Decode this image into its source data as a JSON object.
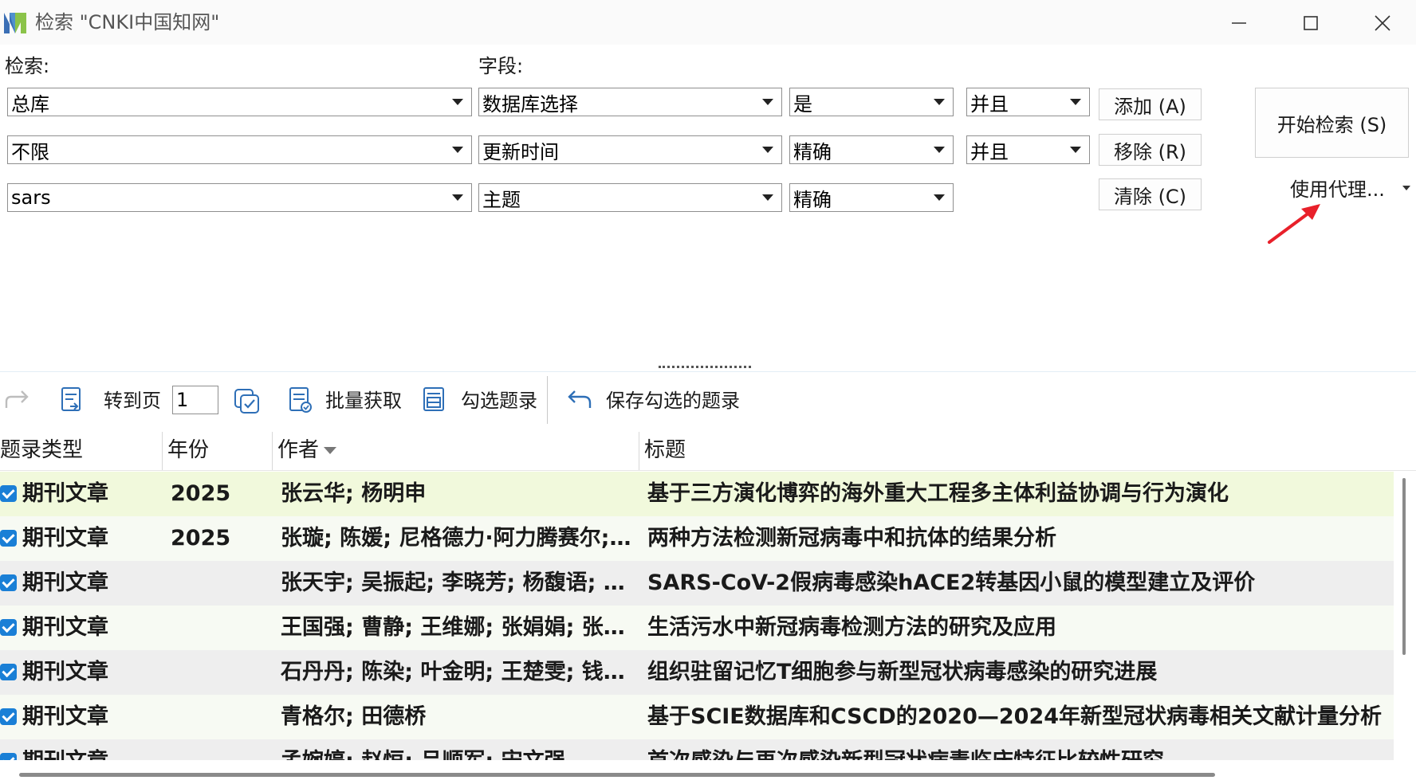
{
  "window": {
    "title": "检索 \"CNKI中国知网\"",
    "icons": {
      "minimize": "minimize-icon",
      "maximize": "maximize-icon",
      "close": "close-icon"
    }
  },
  "form": {
    "search_label": "检索:",
    "field_label": "字段:",
    "rows": [
      {
        "scope": "总库",
        "field": "数据库选择",
        "match": "是",
        "logic": "并且"
      },
      {
        "scope": "不限",
        "field": "更新时间",
        "match": "精确",
        "logic": "并且"
      },
      {
        "scope": "sars",
        "field": "主题",
        "match": "精确"
      }
    ],
    "add_label": "添加 (A)",
    "remove_label": "移除 (R)",
    "clear_label": "清除 (C)",
    "start_label": "开始检索 (S)",
    "proxy_label": "使用代理..."
  },
  "toolbar": {
    "goto_label": "转到页",
    "page_value": "1",
    "batch_label": "批量获取",
    "select_label": "勾选题录",
    "save_label": "保存勾选的题录"
  },
  "table": {
    "columns": [
      "题录类型",
      "年份",
      "作者",
      "标题"
    ],
    "rows": [
      {
        "checked": true,
        "type": "期刊文章",
        "year": "2025",
        "authors": "张云华; 杨明申",
        "title": "基于三方演化博弈的海外重大工程多主体利益协调与行为演化"
      },
      {
        "checked": true,
        "type": "期刊文章",
        "year": "2025",
        "authors": "张璇; 陈媛; 尼格德力·阿力腾赛尔; ...",
        "title": "两种方法检测新冠病毒中和抗体的结果分析"
      },
      {
        "checked": true,
        "type": "期刊文章",
        "year": "",
        "authors": "张天宇; 吴振起; 李晓芳; 杨馥语; 王...",
        "title": "SARS-CoV-2假病毒感染hACE2转基因小鼠的模型建立及评价"
      },
      {
        "checked": true,
        "type": "期刊文章",
        "year": "",
        "authors": "王国强; 曹静; 王维娜; 张娟娟; 张媛...",
        "title": "生活污水中新冠病毒检测方法的研究及应用"
      },
      {
        "checked": true,
        "type": "期刊文章",
        "year": "",
        "authors": "石丹丹; 陈染; 叶金明; 王楚雯; 钱国清",
        "title": "组织驻留记忆T细胞参与新型冠状病毒感染的研究进展"
      },
      {
        "checked": true,
        "type": "期刊文章",
        "year": "",
        "authors": "青格尔; 田德桥",
        "title": "基于SCIE数据库和CSCD的2020—2024年新型冠状病毒相关文献计量分析"
      },
      {
        "checked": true,
        "type": "期刊文章",
        "year": "",
        "authors": "孟婉婷; 赵恒; 吕顺军; 宋文强",
        "title": "首次感染与再次感染新型冠状病毒临床特征比较性研究"
      }
    ]
  },
  "colors": {
    "selected_row": "#f1f9dc",
    "alt_row_a": "#f7faf3",
    "alt_row_b": "#eeeeee",
    "checkbox": "#1a7fd6",
    "accent_arrow": "#e8202a"
  }
}
